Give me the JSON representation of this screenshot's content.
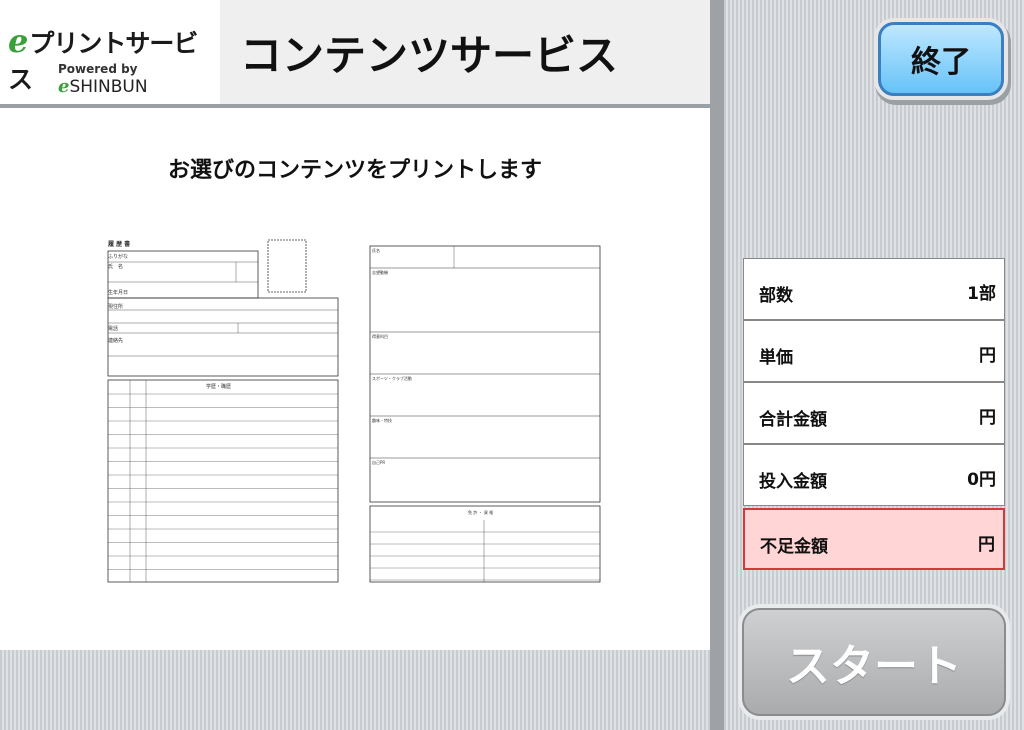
{
  "header": {
    "logo_main": "プリントサービス",
    "logo_powered": "Powered by",
    "logo_shinbun": "SHINBUN",
    "title": "コンテンツサービス"
  },
  "main": {
    "instruction": "お選びのコンテンツをプリントします"
  },
  "actions": {
    "end_label": "終了",
    "start_label": "スタート"
  },
  "price": {
    "copies_label": "部数",
    "copies_value": "1部",
    "unit_price_label": "単価",
    "unit_price_value": "円",
    "total_label": "合計金額",
    "total_value": "円",
    "inserted_label": "投入金額",
    "inserted_value": "0円",
    "shortage_label": "不足金額",
    "shortage_value": "円"
  },
  "colors": {
    "end_button": "#66c3f8",
    "shortage_bg": "#ffd5d5",
    "shortage_border": "#d23a3a",
    "logo_green": "#3aa13a"
  }
}
